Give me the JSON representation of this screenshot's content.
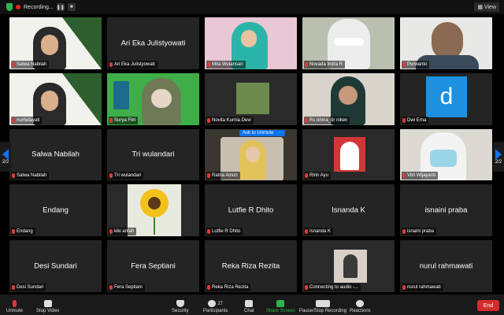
{
  "topbar": {
    "recording_label": "Recording...",
    "pause_glyph": "❚❚",
    "stop_glyph": "■",
    "view_label": "View",
    "view_icon": "grid-icon"
  },
  "navigation": {
    "left_page": "2/2",
    "right_page": "2/2"
  },
  "tiles": [
    {
      "name": "Salwa Nabilah",
      "label": "Salwa Nabilah",
      "muted": true,
      "video": "slide-person"
    },
    {
      "name": "Ari Eka Julistyowati",
      "label": "Ari Eka Julistyowati",
      "muted": true,
      "video": "none"
    },
    {
      "name": "Mita Wulansari",
      "label": "Mita Wulansari",
      "muted": true,
      "video": "pink-scene"
    },
    {
      "name": "Novada Indra R",
      "label": "Novada Indra R",
      "muted": true,
      "video": "masked-man"
    },
    {
      "name": "Purwanto",
      "label": "Purwanto",
      "muted": true,
      "video": "man"
    },
    {
      "name": "nurhidayati",
      "label": "nurhidayati",
      "muted": true,
      "video": "slide-person"
    },
    {
      "name": "Surya Fitri",
      "label": "Surya Fitri",
      "muted": true,
      "video": "green-bg"
    },
    {
      "name": "Novita Kurnia Devi",
      "label": "Novita Kurnia Devi",
      "muted": true,
      "video": "small-photo"
    },
    {
      "name": "Rs bhina_dr niken",
      "label": "Rs bhina_dr niken",
      "muted": true,
      "video": "woman-hijab-dark"
    },
    {
      "name": "Dwi Erna",
      "label": "Dwi Erna",
      "muted": true,
      "video": "avatar-d"
    },
    {
      "name": "Salwa Nabilah",
      "label": "Salwa Nabilah",
      "muted": true,
      "video": "none"
    },
    {
      "name": "Tri wulandari",
      "label": "Tri wulandari",
      "muted": true,
      "video": "none"
    },
    {
      "name": "Ratna Ainun",
      "label": "Ratna Ainun",
      "muted": true,
      "video": "car-selfie",
      "ask_unmute": "Ask to Unmute",
      "more": "···"
    },
    {
      "name": "Ririn Ayu",
      "label": "Ririn Ayu",
      "muted": true,
      "video": "red-photo"
    },
    {
      "name": "Vitri Wijayanti",
      "label": "Vitri Wijayanti",
      "muted": true,
      "video": "masked-woman"
    },
    {
      "name": "Endang",
      "label": "Endang",
      "muted": true,
      "video": "none"
    },
    {
      "name": "kiki arifah",
      "label": "kiki arifah",
      "muted": true,
      "video": "sunflower"
    },
    {
      "name": "Lutfie R Dhito",
      "label": "Lutfie R Dhito",
      "muted": true,
      "video": "none"
    },
    {
      "name": "Isnanda K",
      "label": "Isnanda K",
      "muted": true,
      "video": "none"
    },
    {
      "name": "isnaini praba",
      "label": "isnaini praba",
      "muted": true,
      "video": "none"
    },
    {
      "name": "Desi Sundari",
      "label": "Desi Sundari",
      "muted": true,
      "video": "none"
    },
    {
      "name": "Fera Septiani",
      "label": "Fera Septiani",
      "muted": true,
      "video": "none"
    },
    {
      "name": "Reka Riza Rezita",
      "label": "Reka Riza Rezita",
      "muted": true,
      "video": "none"
    },
    {
      "name": "Connecting to audio",
      "label": "Connecting to audio -...",
      "muted": true,
      "video": "small-photo-woman"
    },
    {
      "name": "nurul rahmawati",
      "label": "nurul rahmawati",
      "muted": true,
      "video": "none"
    }
  ],
  "toolbar": {
    "unmute": "Unmute",
    "stop_video": "Stop Video",
    "security": "Security",
    "participants": "Participants",
    "participants_count": "27",
    "chat": "Chat",
    "share_screen": "Share Screen",
    "record": "Pause/Stop Recording",
    "reactions": "Reactions",
    "end": "End"
  },
  "colors": {
    "accent": "#0e72ed",
    "active_speaker": "#b8d93b",
    "end": "#d32c2c",
    "share": "#2eb44a"
  }
}
